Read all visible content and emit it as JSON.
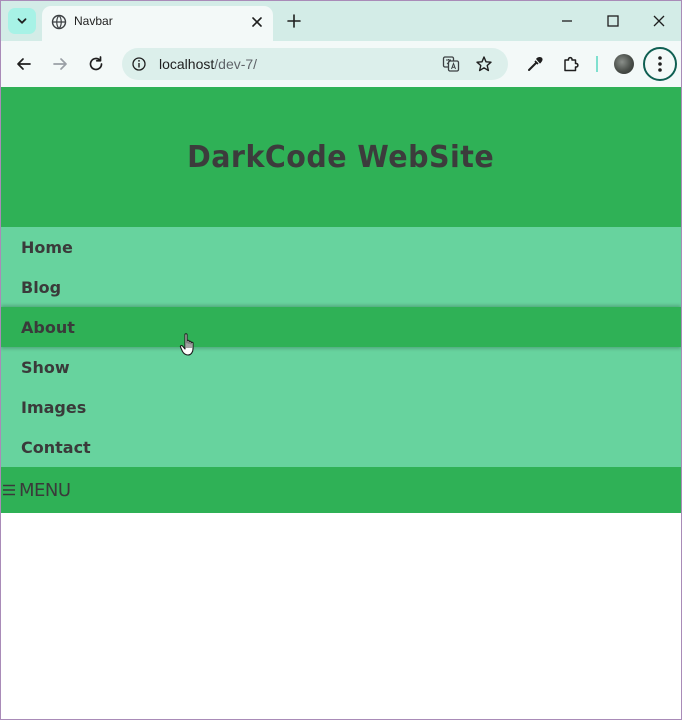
{
  "browser": {
    "tab": {
      "title": "Navbar"
    },
    "omnibox": {
      "host": "localhost",
      "path": "/dev-7/"
    }
  },
  "site": {
    "title": "DarkCode WebSite",
    "nav": [
      {
        "label": "Home"
      },
      {
        "label": "Blog"
      },
      {
        "label": "About",
        "state": "hover"
      },
      {
        "label": "Show"
      },
      {
        "label": "Images"
      },
      {
        "label": "Contact"
      }
    ],
    "menu_label": "MENU"
  },
  "colors": {
    "header_green": "#2fb156",
    "nav_green": "#67d39e",
    "text_dark": "#3a3a3a",
    "browser_frame": "#d3ece7"
  },
  "icons": [
    "tab-search-icon",
    "globe-icon",
    "close-icon",
    "plus-icon",
    "minimize-icon",
    "maximize-icon",
    "back-icon",
    "forward-icon",
    "reload-icon",
    "info-icon",
    "translate-icon",
    "star-icon",
    "eyedropper-icon",
    "extensions-icon",
    "profile-avatar",
    "kebab-menu-icon",
    "hamburger-icon",
    "hand-cursor-icon"
  ]
}
